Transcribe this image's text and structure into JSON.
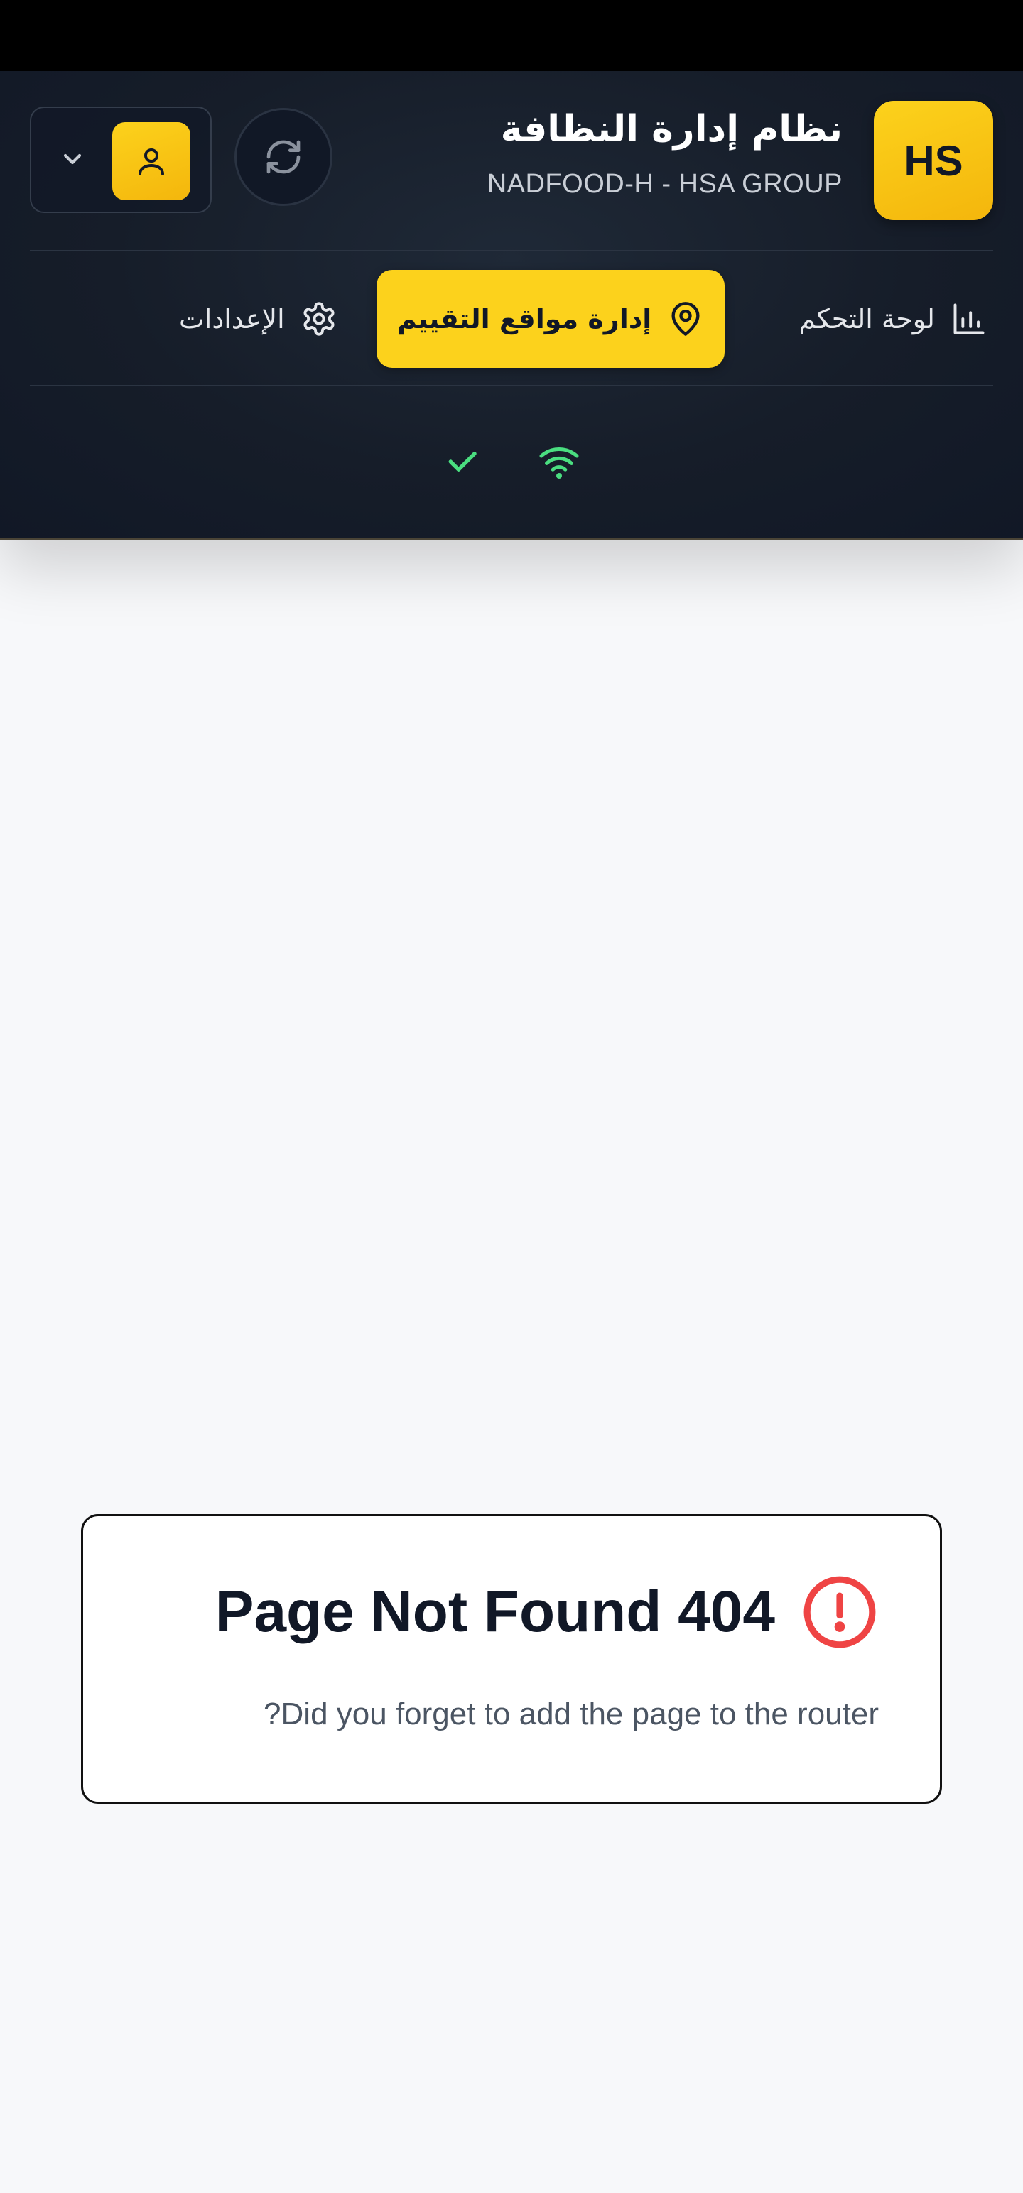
{
  "header": {
    "logo_text": "HS",
    "app_title": "نظام إدارة النظافة",
    "app_subtitle": "NADFOOD-H - HSA GROUP",
    "brand_color": "#fcd21c",
    "background_color": "#161d29"
  },
  "nav": {
    "items": [
      {
        "label": "لوحة التحكم",
        "icon": "bar-chart-icon",
        "active": false
      },
      {
        "label": "إدارة مواقع التقييم",
        "icon": "map-pin-icon",
        "active": true
      },
      {
        "label": "الإعدادات",
        "icon": "gear-icon",
        "active": false
      }
    ]
  },
  "status": {
    "sync_icon": "check-icon",
    "connection_icon": "wifi-icon",
    "status_color": "#4ade80"
  },
  "user_menu": {
    "avatar_icon": "user-icon",
    "dropdown_icon": "chevron-down-icon"
  },
  "toolbar": {
    "refresh_icon": "refresh-icon"
  },
  "error": {
    "title": "404 Page Not Found",
    "message": "Did you forget to add the page to the router?",
    "icon": "alert-circle-icon",
    "icon_color": "#ef4444"
  }
}
